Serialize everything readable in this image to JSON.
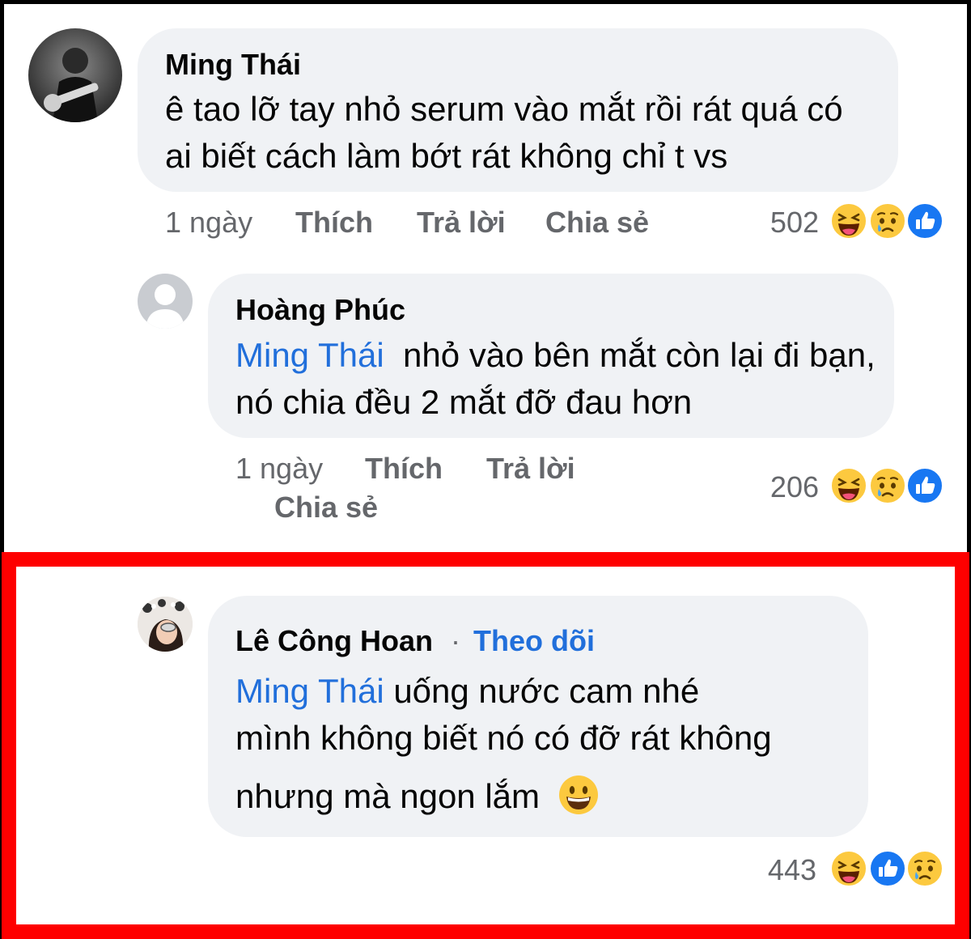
{
  "comments": [
    {
      "author": "Ming Thái",
      "text": "ê tao lỡ tay nhỏ serum vào mắt rồi rát quá có ai biết cách làm bớt rát không chỉ t vs",
      "time": "1 ngày",
      "actions": {
        "like": "Thích",
        "reply": "Trả lời",
        "share": "Chia sẻ"
      },
      "reaction_count": "502",
      "reactions": [
        "haha-icon",
        "sad-icon",
        "like-icon"
      ]
    },
    {
      "author": "Hoàng Phúc",
      "mention": "Ming Thái",
      "text": "nhỏ vào bên mắt còn lại đi bạn, nó chia đều 2 mắt đỡ đau hơn",
      "time": "1 ngày",
      "actions": {
        "like": "Thích",
        "reply": "Trả lời",
        "share": "Chia sẻ"
      },
      "reaction_count": "206",
      "reactions": [
        "haha-icon",
        "sad-icon",
        "like-icon"
      ]
    },
    {
      "author": "Lê Công Hoan",
      "separator": "·",
      "follow": "Theo dõi",
      "mention": "Ming Thái",
      "text_line1": "uống nước cam nhé",
      "text_line2": "mình không biết nó có đỡ rát không",
      "text_line3": "nhưng mà ngon lắm",
      "inline_emoji": "grinning-face-icon",
      "reaction_count": "443",
      "reactions": [
        "haha-icon",
        "like-icon",
        "sad-icon"
      ]
    }
  ],
  "colors": {
    "mention": "#216fdb",
    "bubble": "#f0f2f5",
    "meta": "#65676b",
    "highlight": "#fe0000",
    "like": "#1877f2"
  }
}
